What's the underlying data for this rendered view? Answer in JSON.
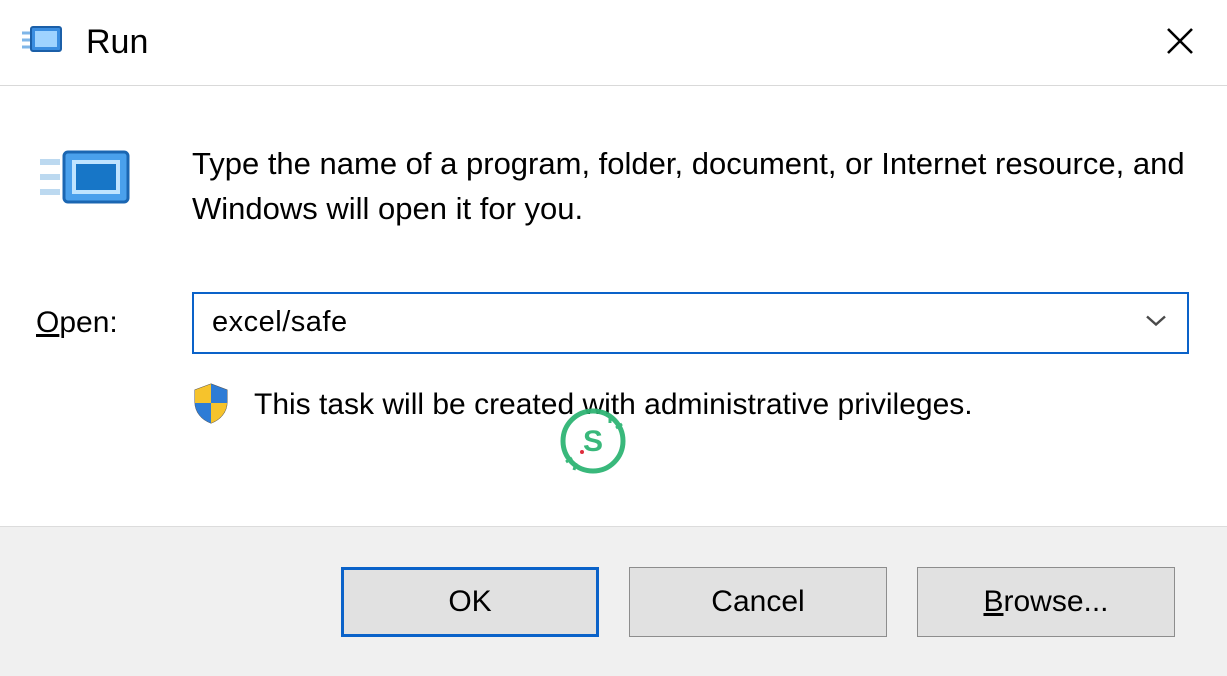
{
  "window": {
    "title": "Run"
  },
  "content": {
    "description": "Type the name of a program, folder, document, or Internet resource, and Windows will open it for you.",
    "open_label_u": "O",
    "open_label_rest": "pen:",
    "open_value": "excel/safe",
    "admin_note": "This task will be created with administrative privileges."
  },
  "buttons": {
    "ok": "OK",
    "cancel": "Cancel",
    "browse_u": "B",
    "browse_rest": "rowse..."
  },
  "icons": {
    "run": "run-icon",
    "shield": "shield-icon",
    "close": "close-icon",
    "chevron": "chevron-down-icon"
  }
}
